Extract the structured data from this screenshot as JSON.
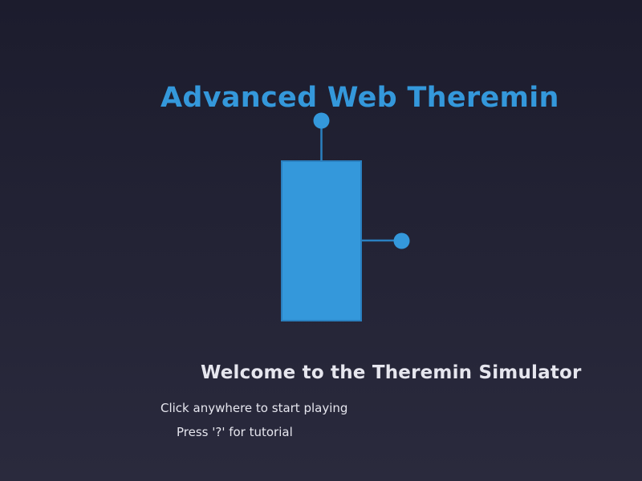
{
  "app": {
    "title": "Advanced Web Theremin"
  },
  "welcome": {
    "heading": "Welcome to the Theremin Simulator",
    "instruction_start": "Click anywhere to start playing",
    "instruction_tutorial": "Press '?' for tutorial"
  },
  "icons": {
    "instrument": "theremin-icon",
    "pitch_antenna": "pitch-antenna-icon",
    "volume_antenna": "volume-antenna-icon"
  },
  "colors": {
    "background_top": "#1c1c2d",
    "background_bottom": "#2a2a3d",
    "accent": "#3498db",
    "antenna_line": "#2a80c0",
    "text": "#e6e6ee"
  }
}
